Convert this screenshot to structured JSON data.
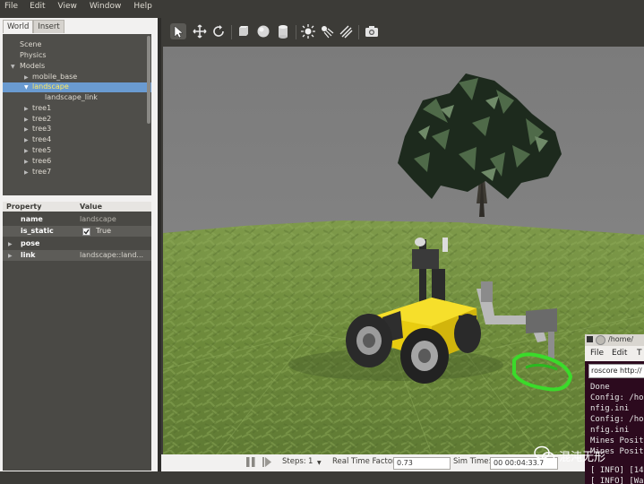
{
  "menubar": {
    "items": [
      "File",
      "Edit",
      "View",
      "Window",
      "Help"
    ]
  },
  "left_panel": {
    "tabs": [
      "World",
      "Insert"
    ],
    "tree": [
      "Scene",
      "Physics",
      "Models",
      "mobile_base",
      "landscape",
      "landscape_link",
      "tree1",
      "tree2",
      "tree3",
      "tree4",
      "tree5",
      "tree6",
      "tree7"
    ],
    "properties": {
      "header": {
        "property": "Property",
        "value": "Value"
      },
      "rows": [
        {
          "name": "name",
          "value": "landscape"
        },
        {
          "name": "is_static",
          "value": "True"
        },
        {
          "name": "pose",
          "value": ""
        },
        {
          "name": "link",
          "value": "landscape::land..."
        }
      ]
    }
  },
  "bottom_bar": {
    "steps_label": "Steps:",
    "steps_value": "1",
    "rtf_label": "Real Time Factor:",
    "rtf_value": "0.73",
    "sim_time_label": "Sim Time:",
    "sim_time_value": "00 00:04:33.7"
  },
  "terminal": {
    "title": "/home/",
    "menu": [
      "File",
      "Edit",
      "T"
    ],
    "tab": "roscore http://",
    "lines": [
      "Done",
      "Config: /ho",
      "nfig.ini",
      "Config: /ho",
      "nfig.ini",
      "Mines Posit",
      "Mines Posit",
      "",
      "[ INFO] [14",
      "[ INFO] [Wa"
    ]
  },
  "watermark": {
    "text": "混沌无形"
  },
  "colors": {
    "selection": "#6a9bd1",
    "robot_body": "#f0d31a",
    "metal_detector": "#3adb2a",
    "sky": "#7e7e7e",
    "grass": "#6e8a3c"
  }
}
